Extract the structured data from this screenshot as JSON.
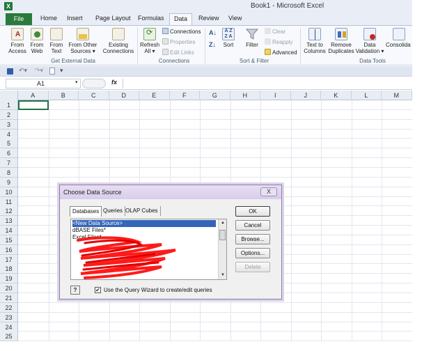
{
  "window": {
    "title": "Book1 - Microsoft Excel",
    "app_icon": "X"
  },
  "tabs": [
    "File",
    "Home",
    "Insert",
    "Page Layout",
    "Formulas",
    "Data",
    "Review",
    "View"
  ],
  "ribbon": {
    "get_external_data": {
      "label": "Get External Data",
      "from_access": [
        "From",
        "Access"
      ],
      "from_web": [
        "From",
        "Web"
      ],
      "from_text": [
        "From",
        "Text"
      ],
      "from_other": [
        "From Other",
        "Sources"
      ],
      "existing": [
        "Existing",
        "Connections"
      ]
    },
    "connections": {
      "label": "Connections",
      "refresh": [
        "Refresh",
        "All"
      ],
      "connections": "Connections",
      "properties": "Properties",
      "edit_links": "Edit Links"
    },
    "sort_filter": {
      "label": "Sort & Filter",
      "sort": "Sort",
      "filter": "Filter",
      "clear": "Clear",
      "reapply": "Reapply",
      "advanced": "Advanced"
    },
    "data_tools": {
      "label": "Data Tools",
      "text_to_columns": [
        "Text to",
        "Columns"
      ],
      "remove_duplicates": [
        "Remove",
        "Duplicates"
      ],
      "data_validation": [
        "Data",
        "Validation"
      ],
      "consolidate": "Consolida"
    }
  },
  "formula_bar": {
    "name_box": "A1",
    "fx": "fx",
    "formula": ""
  },
  "grid": {
    "columns": [
      "A",
      "B",
      "C",
      "D",
      "E",
      "F",
      "G",
      "H",
      "I",
      "J",
      "K",
      "L",
      "M"
    ],
    "rows": [
      "1",
      "2",
      "3",
      "4",
      "5",
      "6",
      "7",
      "8",
      "9",
      "10",
      "11",
      "12",
      "13",
      "14",
      "15",
      "16",
      "17",
      "18",
      "19",
      "20",
      "21",
      "22",
      "23",
      "24",
      "25"
    ]
  },
  "dialog": {
    "title": "Choose Data Source",
    "close": "X",
    "tabs": [
      "Databases",
      "Queries",
      "OLAP Cubes"
    ],
    "list_items": [
      "<New Data Source>",
      "dBASE Files*",
      "Excel Files*"
    ],
    "buttons": {
      "ok": "OK",
      "cancel": "Cancel",
      "browse": "Browse...",
      "options": "Options...",
      "delete": "Delete"
    },
    "help": "?",
    "checkbox_label": "Use the Query Wizard to create/edit queries",
    "checkbox_checked": true
  },
  "colors": {
    "file_tab": "#2a7a3b",
    "selection": "#3465b8",
    "redaction": "#ff0000",
    "dialog_frame": "#dcd3ea"
  }
}
